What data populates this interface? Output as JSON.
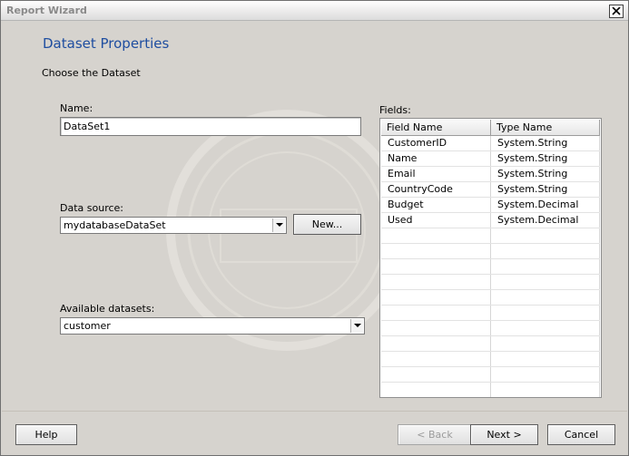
{
  "window": {
    "title": "Report Wizard"
  },
  "page": {
    "heading": "Dataset Properties",
    "subheading": "Choose the Dataset"
  },
  "form": {
    "name_label": "Name:",
    "name_value": "DataSet1",
    "datasource_label": "Data source:",
    "datasource_value": "mydatabaseDataSet",
    "new_button": "New...",
    "datasets_label": "Available datasets:",
    "datasets_value": "customer"
  },
  "fields": {
    "label": "Fields:",
    "columns": [
      "Field Name",
      "Type Name"
    ],
    "rows": [
      {
        "name": "CustomerID",
        "type": "System.String"
      },
      {
        "name": "Name",
        "type": "System.String"
      },
      {
        "name": "Email",
        "type": "System.String"
      },
      {
        "name": "CountryCode",
        "type": "System.String"
      },
      {
        "name": "Budget",
        "type": "System.Decimal"
      },
      {
        "name": "Used",
        "type": "System.Decimal"
      }
    ],
    "empty_rows": 11
  },
  "footer": {
    "help": "Help",
    "back": "< Back",
    "next": "Next >",
    "cancel": "Cancel"
  },
  "colors": {
    "heading": "#1f4ea0",
    "background": "#d6d3ce"
  }
}
